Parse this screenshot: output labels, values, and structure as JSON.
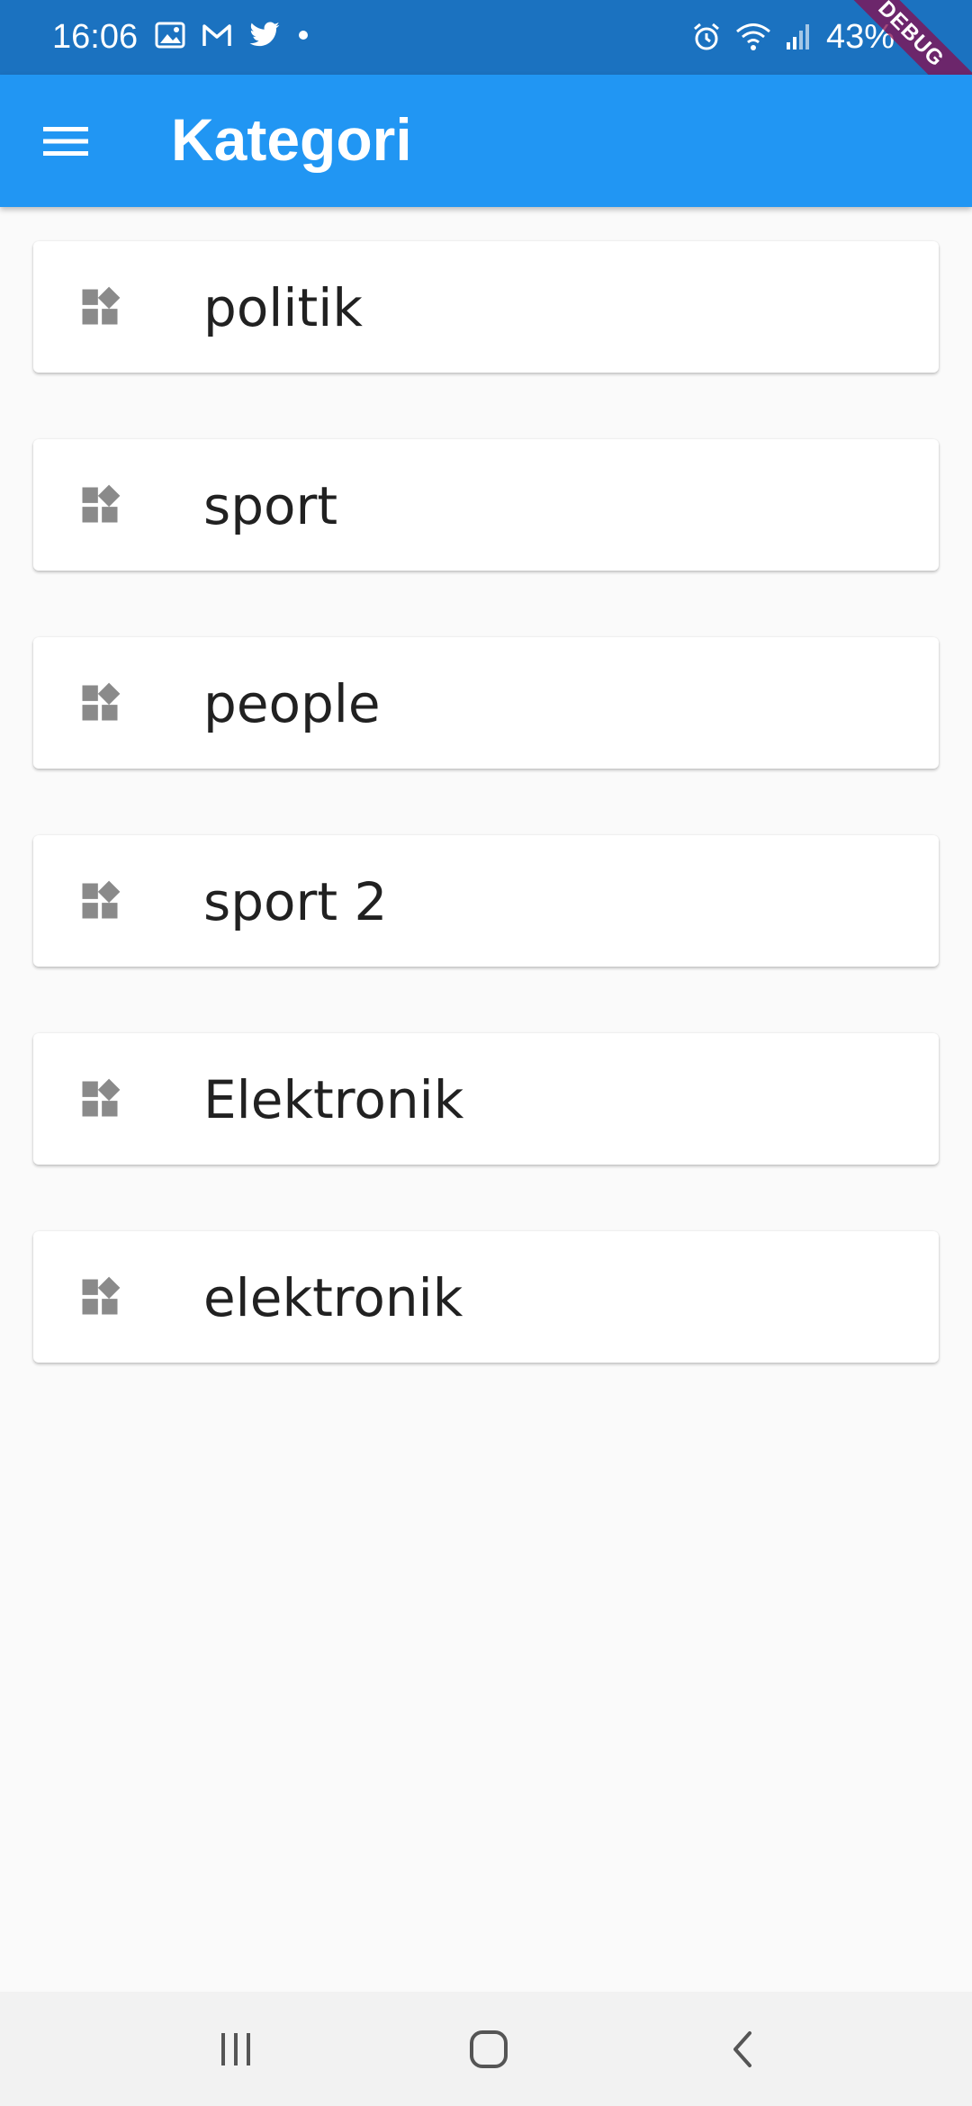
{
  "status_bar": {
    "time": "16:06",
    "battery": "43%",
    "left_icons": [
      "gallery-icon",
      "gmail-icon",
      "twitter-icon",
      "dot-icon"
    ],
    "right_icons": [
      "alarm-icon",
      "wifi-icon",
      "signal-icon"
    ]
  },
  "debug_banner": {
    "label": "DEBUG"
  },
  "app_bar": {
    "title": "Kategori",
    "menu_icon": "menu-icon",
    "background": "#2196f3"
  },
  "categories": [
    {
      "label": "politik",
      "icon": "widgets-icon"
    },
    {
      "label": "sport",
      "icon": "widgets-icon"
    },
    {
      "label": "people",
      "icon": "widgets-icon"
    },
    {
      "label": "sport 2",
      "icon": "widgets-icon"
    },
    {
      "label": "Elektronik",
      "icon": "widgets-icon"
    },
    {
      "label": "elektronik",
      "icon": "widgets-icon"
    }
  ],
  "nav_bar": {
    "buttons": [
      "recent-apps-icon",
      "home-icon",
      "back-icon"
    ]
  },
  "colors": {
    "status_bar": "#1b72c0",
    "app_bar": "#2196f3",
    "icon_grey": "#8a8a8a",
    "text": "#212121",
    "page_bg": "#fafafa"
  }
}
